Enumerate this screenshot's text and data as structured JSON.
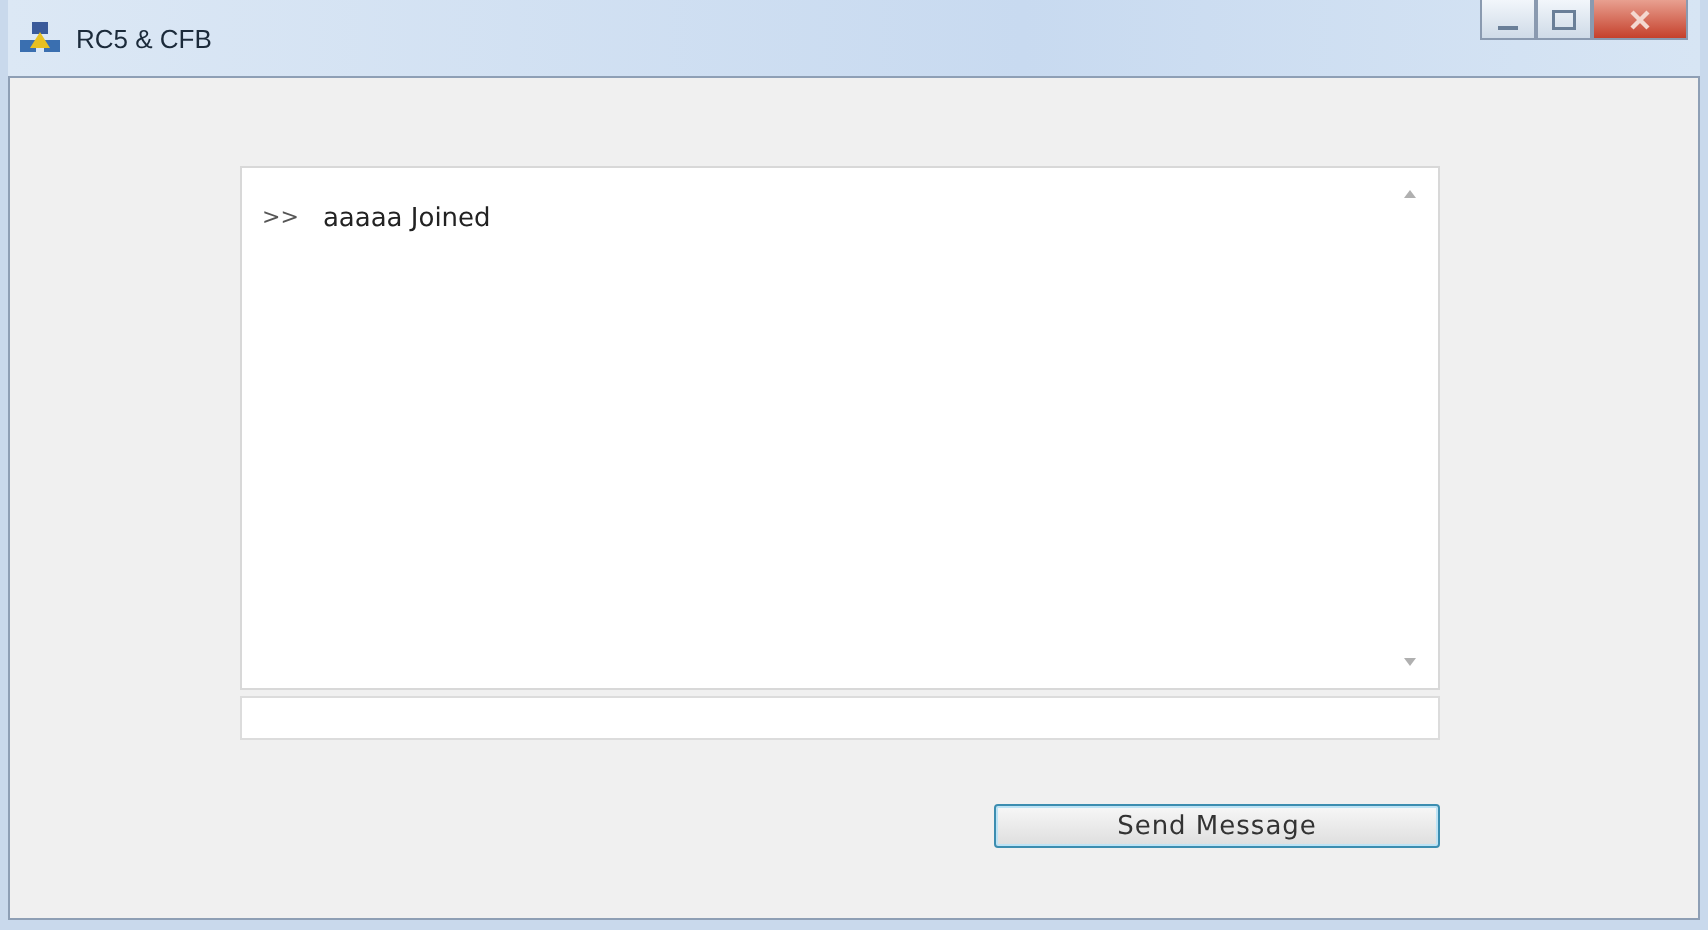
{
  "window": {
    "title": "RC5 & CFB"
  },
  "chat_log": [
    {
      "prefix": ">>",
      "text": "aaaaa Joined"
    }
  ],
  "send_button": "Send Message"
}
